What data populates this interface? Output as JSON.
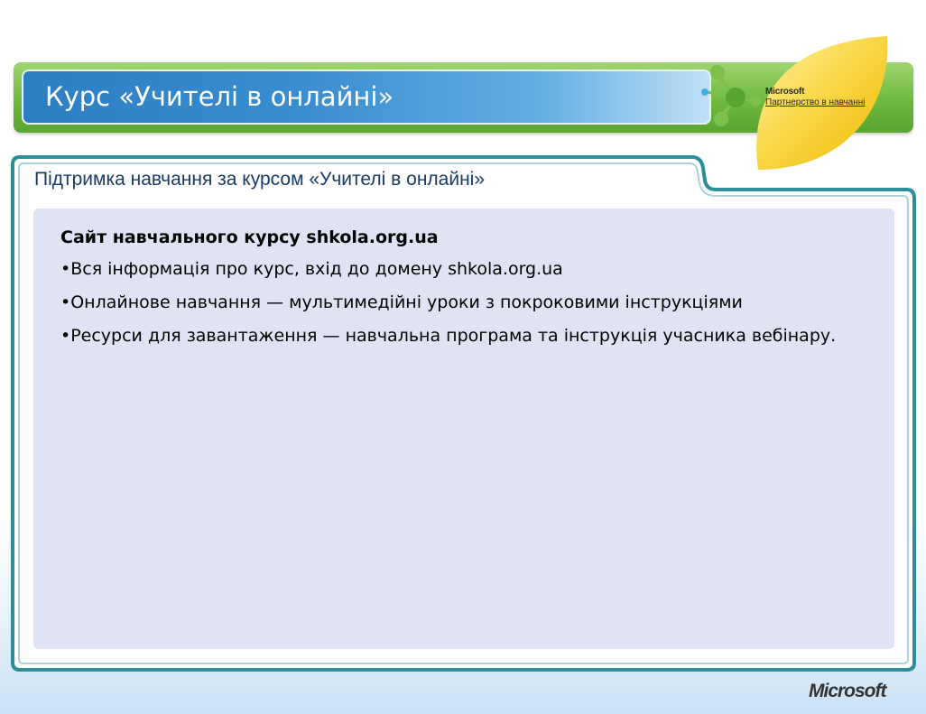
{
  "header": {
    "title": "Курс «Учителі в онлайні»"
  },
  "branding": {
    "partner_brand": "Microsoft",
    "partner_text": "Партнерство в навчанні",
    "footer_logo": "Microsoft"
  },
  "section": {
    "title": "Підтримка навчання за курсом «Учителі в онлайні»",
    "heading": "Сайт навчального курсу shkola.org.ua",
    "bullets": [
      "•Вся інформація про курс, вхід до домену shkola.org.ua",
      "•Онлайнове навчання — мультимедійні уроки з покроковими інструкціями",
      "•Ресурси для завантаження —  навчальна програма та інструкція учасника вебінару."
    ]
  },
  "colors": {
    "header_green": "#6fb83f",
    "header_blue": "#2d7fc3",
    "panel_teal": "#2a8f99",
    "content_bg": "#dfe3f3",
    "leaf_yellow": "#f5c400"
  }
}
